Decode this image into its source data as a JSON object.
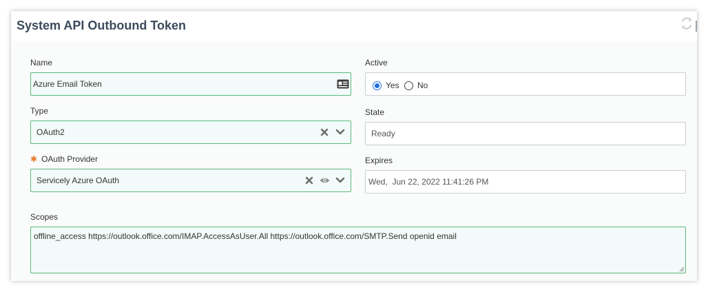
{
  "card": {
    "title": "System API Outbound Token"
  },
  "form": {
    "name": {
      "label": "Name",
      "value": "Azure Email Token"
    },
    "active": {
      "label": "Active",
      "options": [
        "Yes",
        "No"
      ],
      "selected": "Yes"
    },
    "type": {
      "label": "Type",
      "value": "OAuth2"
    },
    "state": {
      "label": "State",
      "value": "Ready"
    },
    "oauth_provider": {
      "label": "OAuth Provider",
      "required_marker": "✱",
      "value": "Servicely Azure OAuth"
    },
    "expires": {
      "label": "Expires",
      "value": "Wed,  Jun 22, 2022 11:41:26 PM"
    },
    "scopes": {
      "label": "Scopes",
      "value": "offline_access https://outlook.office.com/IMAP.AccessAsUser.All https://outlook.office.com/SMTP.Send openid email"
    }
  },
  "icons": {
    "refresh": "refresh-icon",
    "id_card": "id-card-icon",
    "clear": "close-icon",
    "dropdown": "chevron-down-icon",
    "view": "eye-icon"
  },
  "colors": {
    "accent_border": "#5cb878",
    "field_bg": "#f2fbf9",
    "title": "#3d4a5c",
    "radio_selected": "#1f6fe0",
    "required": "#e8772e"
  }
}
